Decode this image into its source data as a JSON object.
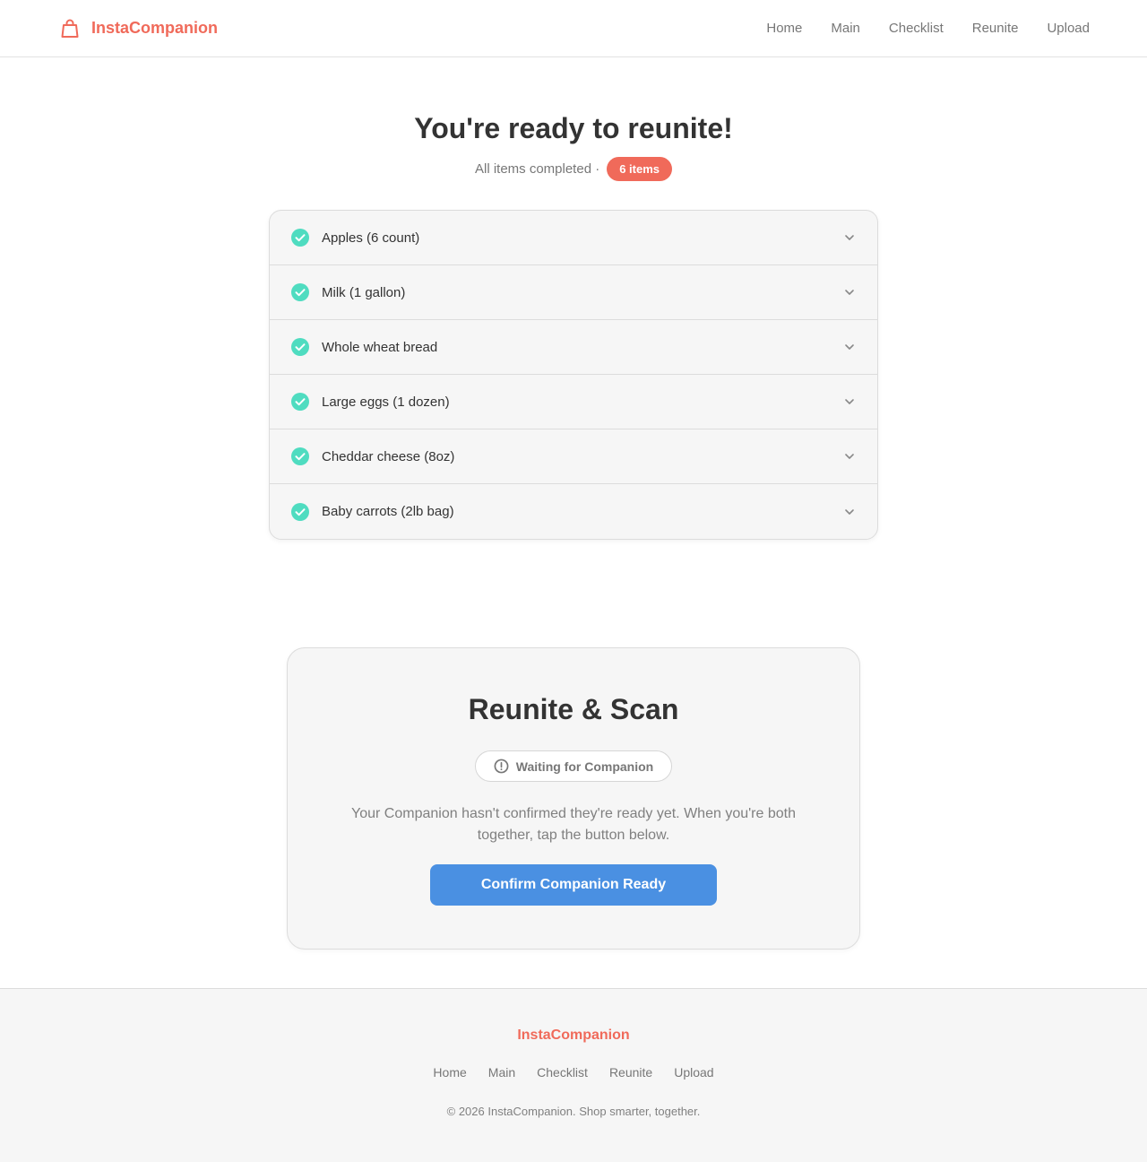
{
  "header": {
    "brand": "InstaCompanion",
    "nav": [
      "Home",
      "Main",
      "Checklist",
      "Reunite",
      "Upload"
    ]
  },
  "hero": {
    "title": "You're ready to reunite!",
    "subtitle": "All items completed ·",
    "badge": "6 items"
  },
  "checklist": {
    "items": [
      {
        "label": "Apples (6 count)",
        "done": true
      },
      {
        "label": "Milk (1 gallon)",
        "done": true
      },
      {
        "label": "Whole wheat bread",
        "done": true
      },
      {
        "label": "Large eggs (1 dozen)",
        "done": true
      },
      {
        "label": "Cheddar cheese (8oz)",
        "done": true
      },
      {
        "label": "Baby carrots (2lb bag)",
        "done": true
      }
    ]
  },
  "reunite": {
    "title": "Reunite & Scan",
    "status": "Waiting for Companion",
    "description": "Your Companion hasn't confirmed they're ready yet. When you're both together, tap the button below.",
    "button_label": "Confirm Companion Ready"
  },
  "footer": {
    "brand": "InstaCompanion",
    "nav": [
      "Home",
      "Main",
      "Checklist",
      "Reunite",
      "Upload"
    ],
    "copyright": "© 2026 InstaCompanion. Shop smarter, together."
  },
  "colors": {
    "brand": "#f06a5a",
    "check": "#4fdcc0",
    "primary_button": "#4a90e2"
  },
  "icons": {
    "brand": "shopping-bag-icon",
    "item_status": "check-circle-icon",
    "item_toggle": "chevron-down-icon",
    "status": "alert-circle-icon"
  }
}
